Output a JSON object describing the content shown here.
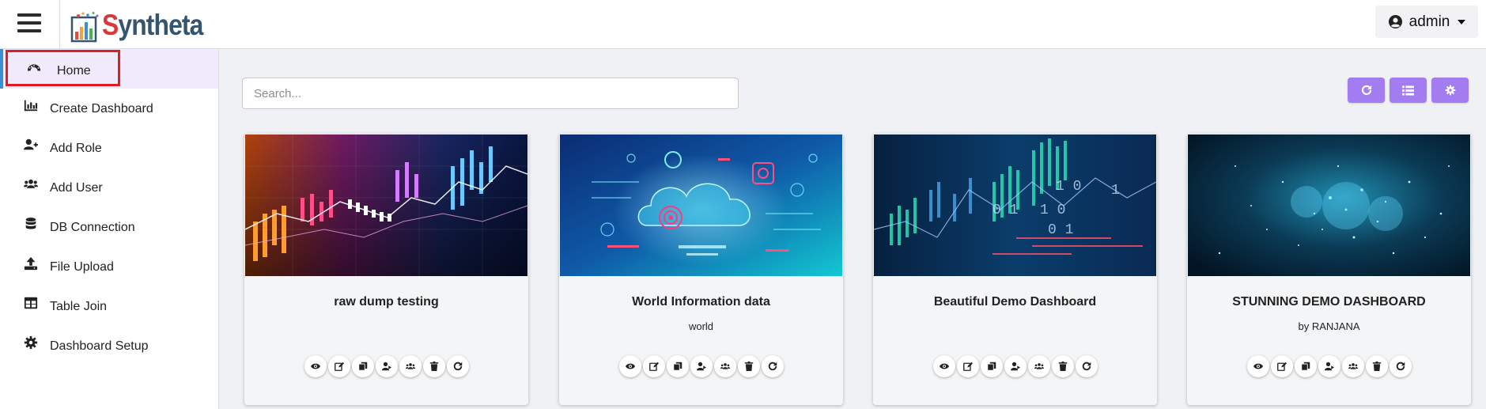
{
  "app": {
    "logo_first_letter": "S",
    "logo_rest": "yntheta"
  },
  "user_menu": {
    "label": "admin"
  },
  "sidebar": {
    "items": [
      {
        "label": "Home",
        "icon": "dashboard-gauge-icon",
        "active": true
      },
      {
        "label": "Create Dashboard",
        "icon": "bar-chart-icon"
      },
      {
        "label": "Add Role",
        "icon": "user-plus-icon"
      },
      {
        "label": "Add User",
        "icon": "users-icon"
      },
      {
        "label": "DB Connection",
        "icon": "database-icon"
      },
      {
        "label": "File Upload",
        "icon": "upload-icon"
      },
      {
        "label": "Table Join",
        "icon": "table-icon"
      },
      {
        "label": "Dashboard Setup",
        "icon": "gear-icon"
      }
    ]
  },
  "search": {
    "placeholder": "Search..."
  },
  "toolbar": {
    "buttons": [
      "refresh-icon",
      "list-icon",
      "settings-icon"
    ]
  },
  "colors": {
    "accent": "#a27cf0",
    "active_bg": "#f1eafc",
    "active_border": "#3c8fd4",
    "highlight": "#e11b22"
  },
  "cards": [
    {
      "title": "raw dump testing",
      "subtitle": ""
    },
    {
      "title": "World Information data",
      "subtitle": "world"
    },
    {
      "title": "Beautiful Demo Dashboard",
      "subtitle": ""
    },
    {
      "title": "STUNNING DEMO DASHBOARD",
      "subtitle": "by RANJANA"
    }
  ],
  "card_actions": [
    "eye-icon",
    "edit-icon",
    "copy-icon",
    "assign-role-icon",
    "assign-users-icon",
    "trash-icon",
    "refresh-icon"
  ]
}
